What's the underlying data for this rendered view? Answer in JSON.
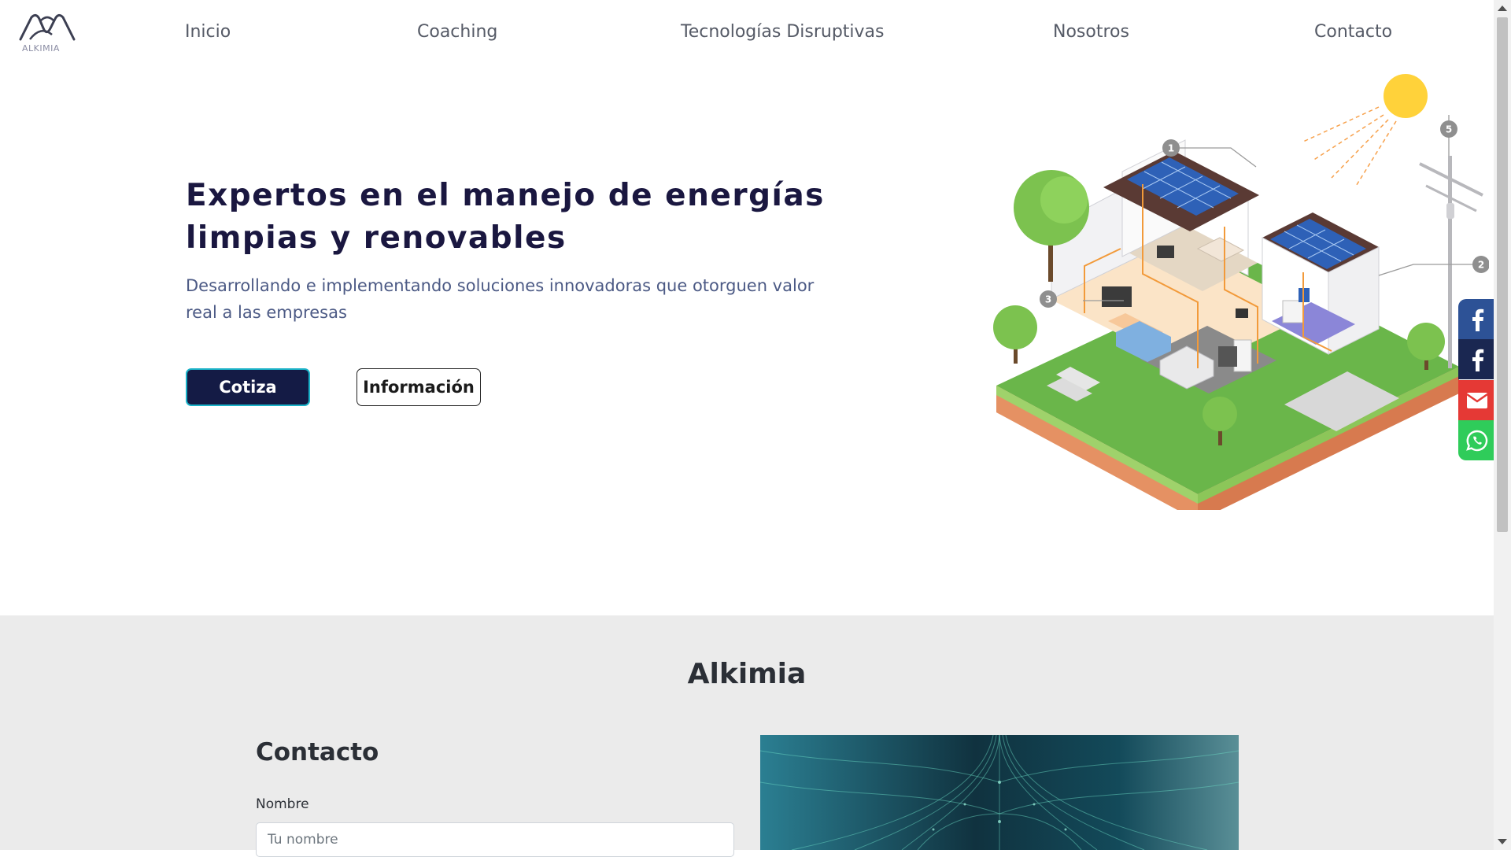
{
  "nav": {
    "logo_text": "ALKIMIA",
    "links": [
      {
        "label": "Inicio"
      },
      {
        "label": "Coaching"
      },
      {
        "label": "Tecnologías Disruptivas"
      },
      {
        "label": "Nosotros"
      },
      {
        "label": "Contacto"
      }
    ]
  },
  "hero": {
    "title": "Expertos en el manejo de energías limpias y renovables",
    "subtitle": "Desarrollando e implementando soluciones innovadoras que otorguen valor real a las empresas",
    "primary_button": "Cotiza",
    "secondary_button": "Información",
    "callouts": [
      "1",
      "2",
      "3",
      "5"
    ]
  },
  "social": [
    {
      "icon": "facebook-icon",
      "color": "#2d5296"
    },
    {
      "icon": "facebook-icon",
      "color": "#1a2751"
    },
    {
      "icon": "mail-icon",
      "color": "#e53935"
    },
    {
      "icon": "whatsapp-icon",
      "color": "#2fcc5a"
    }
  ],
  "about": {
    "title": "Alkimia"
  },
  "contact": {
    "heading": "Contacto",
    "name_label": "Nombre",
    "name_placeholder": "Tu nombre",
    "name_value": ""
  },
  "colors": {
    "brand_navy": "#141b45",
    "accent_teal": "#1ab2c8",
    "title_color": "#1a1740",
    "subtitle_color": "#4c5a85",
    "section_bg": "#ebebeb"
  }
}
